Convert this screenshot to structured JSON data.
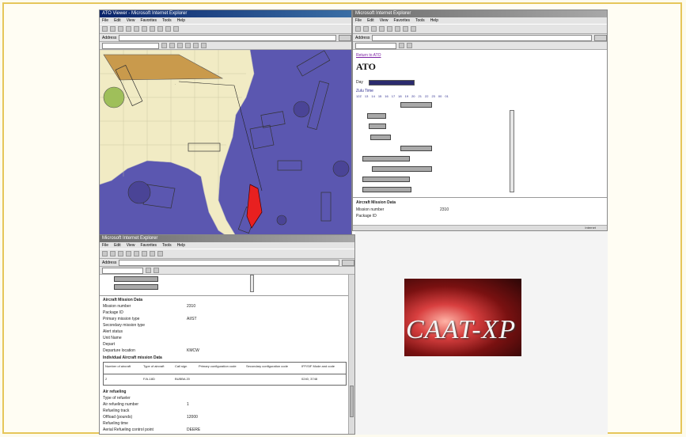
{
  "map_window": {
    "title": "ATO Viewer - Microsoft Internet Explorer",
    "menu": [
      "File",
      "Edit",
      "View",
      "Favorites",
      "Tools",
      "Help"
    ],
    "address_label": "Address",
    "go_label": "Go"
  },
  "ato_window": {
    "title": "Microsoft Internet Explorer",
    "menu": [
      "File",
      "Edit",
      "View",
      "Favorites",
      "Tools",
      "Help"
    ],
    "address_label": "Address",
    "back_link": "Return to ATO",
    "heading": "ATO",
    "day_label": "Day",
    "time_label": "Zulu Time",
    "time_ticks": [
      "12Z",
      "13",
      "14",
      "15",
      "16",
      "17",
      "18",
      "19",
      "20",
      "21",
      "22",
      "23",
      "00",
      "01"
    ],
    "mission_section": "Aircraft Mission Data",
    "mission_number_label": "Mission number",
    "mission_number_value": "2310",
    "package_label": "Package ID",
    "status_text": "Internet"
  },
  "detail_window": {
    "title": "Microsoft Internet Explorer",
    "menu": [
      "File",
      "Edit",
      "View",
      "Favorites",
      "Tools",
      "Help"
    ],
    "address_label": "Address",
    "go_label": "Go",
    "section1": "Aircraft Mission Data",
    "fields": [
      {
        "label": "Mission number",
        "value": "2310"
      },
      {
        "label": "Package ID",
        "value": ""
      },
      {
        "label": "Primary mission type",
        "value": "AI/ST"
      },
      {
        "label": "Secondary mission type",
        "value": ""
      },
      {
        "label": "Alert status",
        "value": ""
      },
      {
        "label": "Unit Name",
        "value": ""
      },
      {
        "label": "Depart",
        "value": ""
      },
      {
        "label": "Departure location",
        "value": "KMCW"
      }
    ],
    "section2": "Individual Aircraft mission Data",
    "table_headers": [
      "Number of aircraft",
      "Type of aircraft",
      "Call sign",
      "Primary configuration code",
      "Secondary configuration code",
      "IFF/SIF Mode and code"
    ],
    "table_row": [
      "2",
      "F/A-18D",
      "BUBBA 20",
      "",
      "",
      "0240, 3748"
    ],
    "section3": "Air refueling",
    "refuel_fields": [
      {
        "label": "Type of refueler",
        "value": ""
      },
      {
        "label": "Air refueling number",
        "value": "1"
      },
      {
        "label": "Refueling track",
        "value": ""
      },
      {
        "label": "Offload (pounds)",
        "value": "12000"
      },
      {
        "label": "Refueling time",
        "value": ""
      },
      {
        "label": "Aerial Refueling control point",
        "value": "DEERE"
      }
    ]
  },
  "logo": {
    "text": "CAAT-XP"
  },
  "colors": {
    "sea": "#5b57b0",
    "land": "#f1ebc4",
    "zone": "#c99a4c",
    "threat": "#e82020"
  }
}
